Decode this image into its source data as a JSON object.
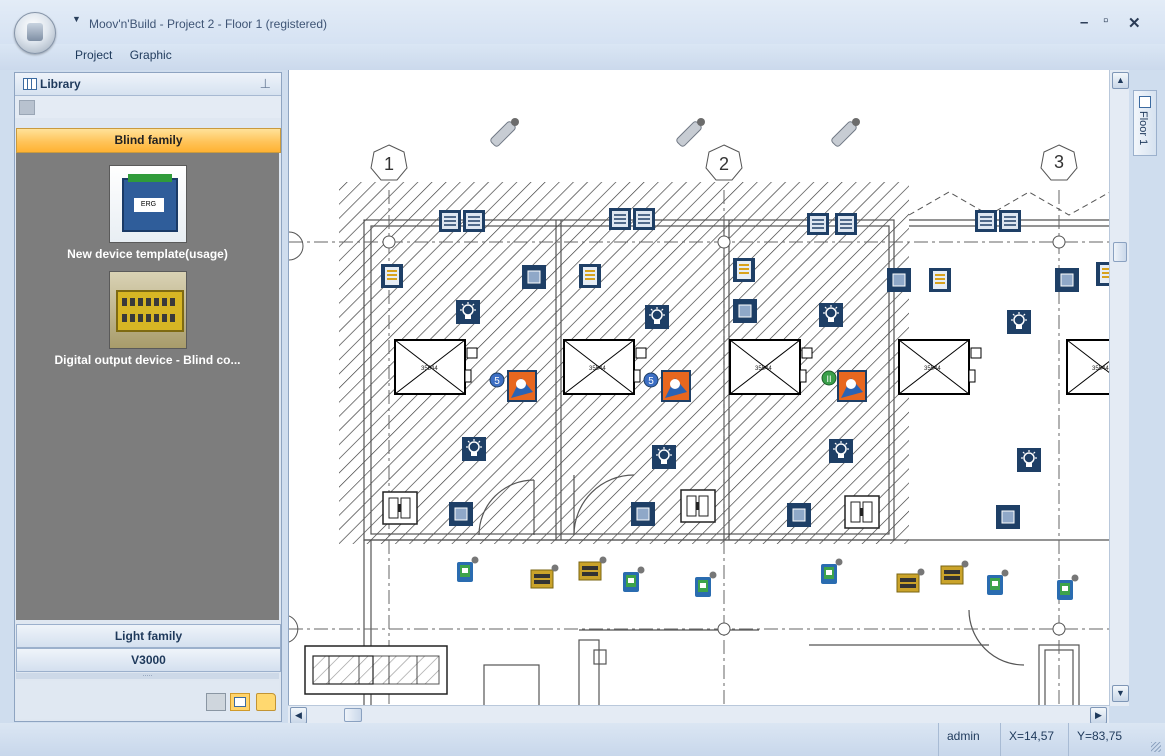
{
  "window": {
    "title": "Moov'n'Build - Project 2 - Floor 1 (registered)",
    "minimize": "–",
    "maximize": "▫",
    "close": "✕"
  },
  "menu": [
    "Project",
    "Graphic"
  ],
  "library": {
    "title": "Library",
    "pin": "⊥",
    "active_family": "Blind family",
    "devices": [
      {
        "label": "New device template(usage)"
      },
      {
        "label": "Digital output device - Blind co..."
      }
    ],
    "other_families": [
      "Light family",
      "V3000"
    ],
    "splitter": "....."
  },
  "floorplan": {
    "axis_labels": [
      "1",
      "2",
      "3"
    ],
    "room_box_text": "35544",
    "badges": [
      "5",
      "5",
      "II"
    ]
  },
  "side_tab": {
    "label": "Floor 1"
  },
  "statusbar": {
    "user": "admin",
    "x": "X=14,57",
    "y": "Y=83,75"
  },
  "colors": {
    "device_icon": "#1e3f66",
    "selected_family": "#ffc45a",
    "library_bg": "#7d7d7d",
    "hatch": "#222222"
  }
}
